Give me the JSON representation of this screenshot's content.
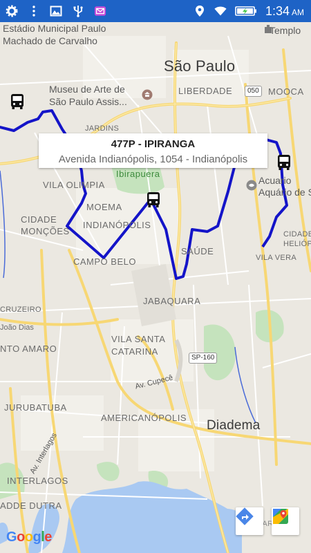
{
  "status_bar": {
    "time": "1:34",
    "am_pm": "AM",
    "icons": [
      "settings-icon",
      "more-icon",
      "image-icon",
      "usb-icon",
      "email-icon",
      "location-icon",
      "wifi-icon",
      "battery-charging-icon"
    ]
  },
  "info_window": {
    "title": "477P - IPIRANGA",
    "address": "Avenida Indianópolis, 1054 - Indianópolis"
  },
  "map_labels": {
    "estadio": "Estádio Municipal Paulo\nMachado de Carvalho",
    "templo": "Templo",
    "sao_paulo": "São Paulo",
    "museu": "Museu de Arte de\nSão Paulo Assis...",
    "liberdade": "LIBERDADE",
    "mooca": "MOOCA",
    "jardins": "JARDINS",
    "ibirapuera": "Ibirapuera",
    "vila_olimpia": "VILA OLIMPIA",
    "acuario": "Acuario\nAquário de S",
    "moema": "MOEMA",
    "cidade_moncoes": "CIDADE\nMONÇÕES",
    "indianopolis": "INDIANÓPOLIS",
    "cidade_heliopolis": "CIDADE\nHELIÓP",
    "saude": "SAÚDE",
    "vila_vera": "VILA VERA",
    "campo_belo": "CAMPO BELO",
    "jabaquara": "JABAQUARA",
    "cruzeiro": "CRUZEIRO",
    "joao_dias": "João Dias",
    "santo_amaro": "NTO AMARO",
    "vila_santa_catarina": "VILA SANTA\nCATARINA",
    "av_cupece": "Av. Cupecê",
    "jurubatuba": "JURUBATUBA",
    "americanopolis": "AMERICANÓPOLIS",
    "diadema": "Diadema",
    "av_interlagos": "Av. Interlagos",
    "interlagos": "INTERLAGOS",
    "adde_dutra": "ADDE DUTRA",
    "mar": "MAR"
  },
  "road_badges": {
    "r050": "050",
    "sp160": "SP-160"
  },
  "controls": {
    "directions": "directions-icon",
    "open_maps": "google-maps-icon"
  },
  "google_logo": [
    "G",
    "o",
    "o",
    "g",
    "l",
    "e"
  ],
  "colors": {
    "route": "#1414c8",
    "status_bar": "#1e63c6",
    "map_bg": "#ebe8e1",
    "highway": "#f7d774",
    "water": "#a9c9f2",
    "park": "#c5e3bd"
  }
}
